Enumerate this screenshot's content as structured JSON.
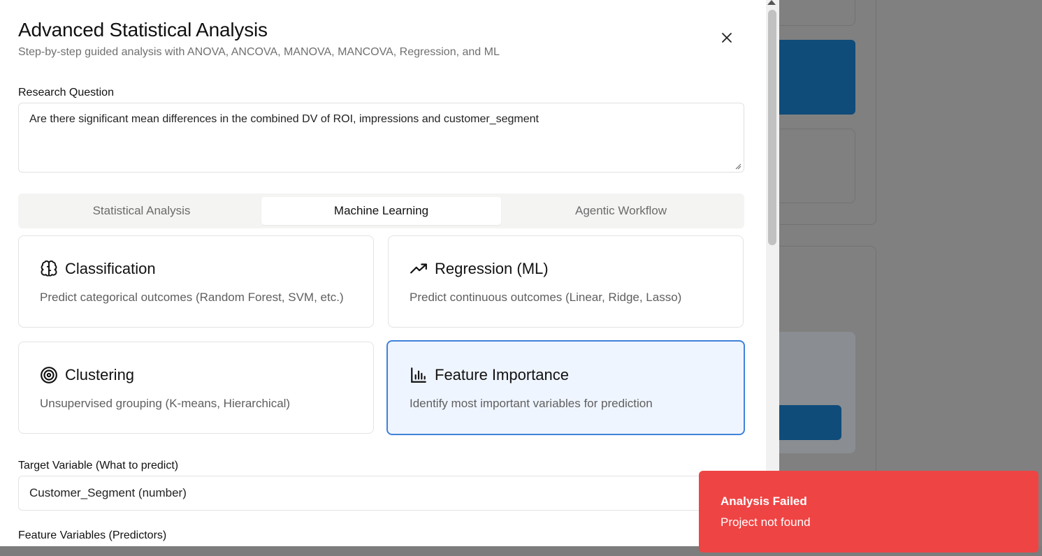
{
  "modal": {
    "title": "Advanced Statistical Analysis",
    "subtitle": "Step-by-step guided analysis with ANOVA, ANCOVA, MANOVA, MANCOVA, Regression, and ML"
  },
  "research": {
    "label": "Research Question",
    "value": "Are there significant mean differences in the combined DV of ROI, impressions and customer_segment"
  },
  "tabs": [
    {
      "label": "Statistical Analysis",
      "active": false
    },
    {
      "label": "Machine Learning",
      "active": true
    },
    {
      "label": "Agentic Workflow",
      "active": false
    }
  ],
  "ml_options": [
    {
      "title": "Classification",
      "description": "Predict categorical outcomes (Random Forest, SVM, etc.)",
      "icon": "brain-icon",
      "selected": false
    },
    {
      "title": "Regression (ML)",
      "description": "Predict continuous outcomes (Linear, Ridge, Lasso)",
      "icon": "trending-up-icon",
      "selected": false
    },
    {
      "title": "Clustering",
      "description": "Unsupervised grouping (K-means, Hierarchical)",
      "icon": "target-icon",
      "selected": false
    },
    {
      "title": "Feature Importance",
      "description": "Identify most important variables for prediction",
      "icon": "bar-chart-icon",
      "selected": true
    }
  ],
  "target": {
    "label": "Target Variable (What to predict)",
    "value": "Customer_Segment (number)"
  },
  "features": {
    "label": "Feature Variables (Predictors)"
  },
  "toast": {
    "title": "Analysis Failed",
    "message": "Project not found",
    "color": "#ef4444"
  },
  "colors": {
    "accent": "#3f82d9",
    "background_block": "#0f4c7a"
  }
}
